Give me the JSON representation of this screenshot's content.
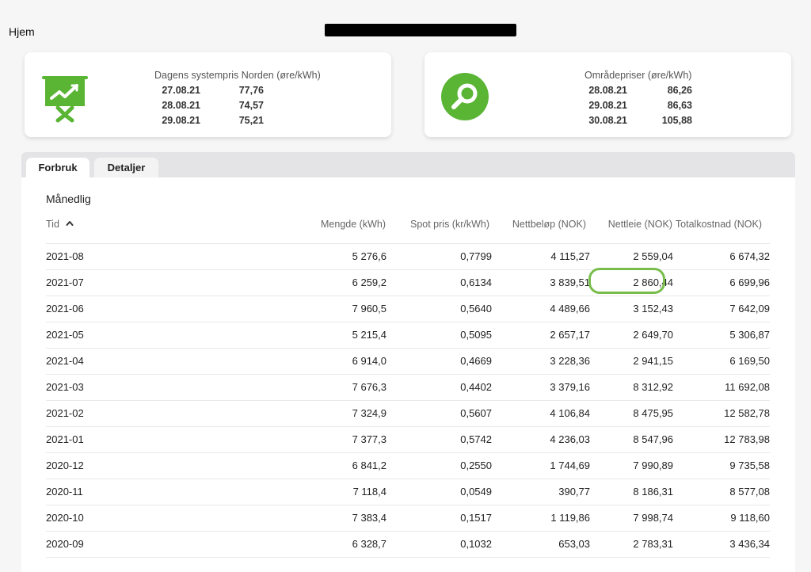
{
  "header": {
    "home_label": "Hjem"
  },
  "cards": {
    "system": {
      "title": "Dagens systempris Norden (øre/kWh)",
      "icon": "presentation-chart-icon",
      "rows": [
        {
          "date": "27.08.21",
          "value": "77,76"
        },
        {
          "date": "28.08.21",
          "value": "74,57"
        },
        {
          "date": "29.08.21",
          "value": "75,21"
        }
      ]
    },
    "area": {
      "title": "Områdepriser (øre/kWh)",
      "icon": "search-icon",
      "rows": [
        {
          "date": "28.08.21",
          "value": "86,26"
        },
        {
          "date": "29.08.21",
          "value": "86,63"
        },
        {
          "date": "30.08.21",
          "value": "105,88"
        }
      ]
    }
  },
  "colors": {
    "accent": "#5ab534",
    "highlight": "#78bd4c"
  },
  "tabs": [
    {
      "label": "Forbruk",
      "active": true
    },
    {
      "label": "Detaljer",
      "active": false
    }
  ],
  "table": {
    "section_title": "Månedlig",
    "columns": [
      "Tid",
      "Mengde (kWh)",
      "Spot pris (kr/kWh)",
      "Nettbeløp (NOK)",
      "Nettleie (NOK)",
      "Totalkostnad (NOK)"
    ],
    "rows": [
      [
        "2021-08",
        "5 276,6",
        "0,7799",
        "4 115,27",
        "2 559,04",
        "6 674,32"
      ],
      [
        "2021-07",
        "6 259,2",
        "0,6134",
        "3 839,51",
        "2 860,44",
        "6 699,96"
      ],
      [
        "2021-06",
        "7 960,5",
        "0,5640",
        "4 489,66",
        "3 152,43",
        "7 642,09"
      ],
      [
        "2021-05",
        "5 215,4",
        "0,5095",
        "2 657,17",
        "2 649,70",
        "5 306,87"
      ],
      [
        "2021-04",
        "6 914,0",
        "0,4669",
        "3 228,36",
        "2 941,15",
        "6 169,50"
      ],
      [
        "2021-03",
        "7 676,3",
        "0,4402",
        "3 379,16",
        "8 312,92",
        "11 692,08"
      ],
      [
        "2021-02",
        "7 324,9",
        "0,5607",
        "4 106,84",
        "8 475,95",
        "12 582,78"
      ],
      [
        "2021-01",
        "7 377,3",
        "0,5742",
        "4 236,03",
        "8 547,96",
        "12 783,98"
      ],
      [
        "2020-12",
        "6 841,2",
        "0,2550",
        "1 744,69",
        "7 990,89",
        "9 735,58"
      ],
      [
        "2020-11",
        "7 118,4",
        "0,0549",
        "390,77",
        "8 186,31",
        "8 577,08"
      ],
      [
        "2020-10",
        "7 383,4",
        "0,1517",
        "1 119,86",
        "7 998,74",
        "9 118,60"
      ],
      [
        "2020-09",
        "6 328,7",
        "0,1032",
        "653,03",
        "2 783,31",
        "3 436,34"
      ]
    ]
  }
}
